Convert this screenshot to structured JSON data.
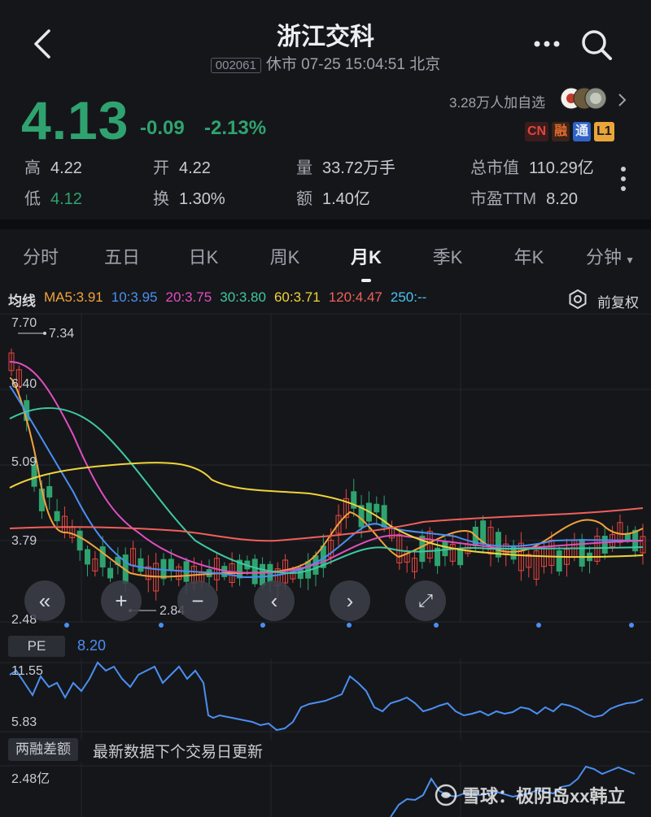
{
  "header": {
    "title": "浙江交科",
    "code": "002061",
    "status_line": "休市 07-25 15:04:51 北京"
  },
  "quote": {
    "price": "4.13",
    "change": "-0.09",
    "change_pct": "-2.13%",
    "watchers": "3.28万人加自选",
    "badges": [
      "CN",
      "融",
      "通",
      "L1"
    ]
  },
  "stats": {
    "high_label": "高",
    "high": "4.22",
    "low_label": "低",
    "low": "4.12",
    "open_label": "开",
    "open": "4.22",
    "turnover_label": "换",
    "turnover": "1.30%",
    "volume_label": "量",
    "volume": "33.72万手",
    "amount_label": "额",
    "amount": "1.40亿",
    "mktcap_label": "总市值",
    "mktcap": "110.29亿",
    "pe_label": "市盈TTM",
    "pe": "8.20"
  },
  "tabs": [
    "分时",
    "五日",
    "日K",
    "周K",
    "月K",
    "季K",
    "年K",
    "分钟"
  ],
  "active_tab": "月K",
  "ma": {
    "title": "均线",
    "items": [
      {
        "label": "MA5:3.91",
        "color": "#f2a33a"
      },
      {
        "label": "10:3.95",
        "color": "#4a8ff2"
      },
      {
        "label": "20:3.75",
        "color": "#e04fbf"
      },
      {
        "label": "30:3.80",
        "color": "#3ec8a2"
      },
      {
        "label": "60:3.71",
        "color": "#f0d43a"
      },
      {
        "label": "120:4.47",
        "color": "#f0605a"
      },
      {
        "label": "250:--",
        "color": "#4cc3f0"
      }
    ],
    "adjust": "前复权"
  },
  "chart_data": {
    "type": "candlestick",
    "y_ticks": [
      "7.70",
      "6.40",
      "5.09",
      "3.79",
      "2.48"
    ],
    "ylim": [
      2.48,
      7.7
    ],
    "high_marker": "7.34",
    "low_marker": "2.84"
  },
  "controls": [
    "rewind",
    "zoom-in",
    "zoom-out",
    "prev",
    "next",
    "fullscreen"
  ],
  "pe": {
    "label": "PE",
    "value": "8.20",
    "y_ticks": [
      "11.55",
      "5.83"
    ],
    "color": "#4a8ff2"
  },
  "margin": {
    "label": "两融差额",
    "note": "最新数据下个交易日更新",
    "y_tick": "2.48亿"
  },
  "watermark": "雪球：极阴岛xx韩立",
  "colors": {
    "up": "#e8473f",
    "down": "#2fa36f",
    "bg": "#15161a"
  }
}
